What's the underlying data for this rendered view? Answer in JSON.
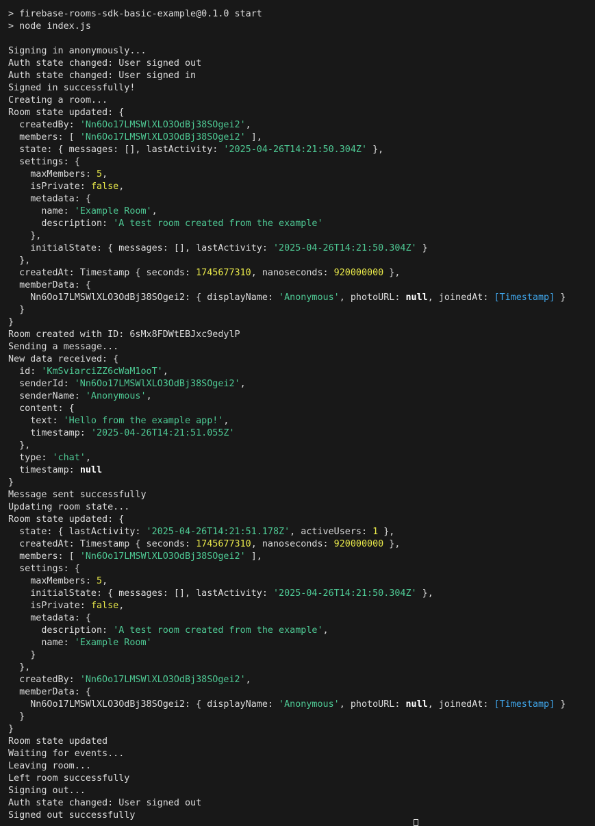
{
  "colors": {
    "background": "#181818",
    "text": "#dcdcdc",
    "string": "#4ec994",
    "number": "#e8e84a",
    "null": "#ffffff",
    "special": "#3fa4e8"
  },
  "lines": [
    [
      [
        "t",
        "> firebase-rooms-sdk-basic-example@0.1.0 start"
      ]
    ],
    [
      [
        "t",
        "> node index.js"
      ]
    ],
    [],
    [
      [
        "t",
        "Signing in anonymously..."
      ]
    ],
    [
      [
        "t",
        "Auth state changed: User signed out"
      ]
    ],
    [
      [
        "t",
        "Auth state changed: User signed in"
      ]
    ],
    [
      [
        "t",
        "Signed in successfully!"
      ]
    ],
    [
      [
        "t",
        "Creating a room..."
      ]
    ],
    [
      [
        "t",
        "Room state updated: {"
      ]
    ],
    [
      [
        "t",
        "  createdBy: "
      ],
      [
        "s",
        "'Nn6Oo17LMSWlXLO3OdBj38SOgei2'"
      ],
      [
        "t",
        ","
      ]
    ],
    [
      [
        "t",
        "  members: [ "
      ],
      [
        "s",
        "'Nn6Oo17LMSWlXLO3OdBj38SOgei2'"
      ],
      [
        "t",
        " ],"
      ]
    ],
    [
      [
        "t",
        "  state: { messages: [], lastActivity: "
      ],
      [
        "s",
        "'2025-04-26T14:21:50.304Z'"
      ],
      [
        "t",
        " },"
      ]
    ],
    [
      [
        "t",
        "  settings: {"
      ]
    ],
    [
      [
        "t",
        "    maxMembers: "
      ],
      [
        "n",
        "5"
      ],
      [
        "t",
        ","
      ]
    ],
    [
      [
        "t",
        "    isPrivate: "
      ],
      [
        "n",
        "false"
      ],
      [
        "t",
        ","
      ]
    ],
    [
      [
        "t",
        "    metadata: {"
      ]
    ],
    [
      [
        "t",
        "      name: "
      ],
      [
        "s",
        "'Example Room'"
      ],
      [
        "t",
        ","
      ]
    ],
    [
      [
        "t",
        "      description: "
      ],
      [
        "s",
        "'A test room created from the example'"
      ]
    ],
    [
      [
        "t",
        "    },"
      ]
    ],
    [
      [
        "t",
        "    initialState: { messages: [], lastActivity: "
      ],
      [
        "s",
        "'2025-04-26T14:21:50.304Z'"
      ],
      [
        "t",
        " }"
      ]
    ],
    [
      [
        "t",
        "  },"
      ]
    ],
    [
      [
        "t",
        "  createdAt: Timestamp { seconds: "
      ],
      [
        "n",
        "1745677310"
      ],
      [
        "t",
        ", nanoseconds: "
      ],
      [
        "n",
        "920000000"
      ],
      [
        "t",
        " },"
      ]
    ],
    [
      [
        "t",
        "  memberData: {"
      ]
    ],
    [
      [
        "t",
        "    Nn6Oo17LMSWlXLO3OdBj38SOgei2: { displayName: "
      ],
      [
        "s",
        "'Anonymous'"
      ],
      [
        "t",
        ", photoURL: "
      ],
      [
        "k",
        "null"
      ],
      [
        "t",
        ", joinedAt: "
      ],
      [
        "c",
        "[Timestamp]"
      ],
      [
        "t",
        " }"
      ]
    ],
    [
      [
        "t",
        "  }"
      ]
    ],
    [
      [
        "t",
        "}"
      ]
    ],
    [
      [
        "t",
        "Room created with ID: 6sMx8FDWtEBJxc9edylP"
      ]
    ],
    [
      [
        "t",
        "Sending a message..."
      ]
    ],
    [
      [
        "t",
        "New data received: {"
      ]
    ],
    [
      [
        "t",
        "  id: "
      ],
      [
        "s",
        "'KmSviarciZZ6cWaM1ooT'"
      ],
      [
        "t",
        ","
      ]
    ],
    [
      [
        "t",
        "  senderId: "
      ],
      [
        "s",
        "'Nn6Oo17LMSWlXLO3OdBj38SOgei2'"
      ],
      [
        "t",
        ","
      ]
    ],
    [
      [
        "t",
        "  senderName: "
      ],
      [
        "s",
        "'Anonymous'"
      ],
      [
        "t",
        ","
      ]
    ],
    [
      [
        "t",
        "  content: {"
      ]
    ],
    [
      [
        "t",
        "    text: "
      ],
      [
        "s",
        "'Hello from the example app!'"
      ],
      [
        "t",
        ","
      ]
    ],
    [
      [
        "t",
        "    timestamp: "
      ],
      [
        "s",
        "'2025-04-26T14:21:51.055Z'"
      ]
    ],
    [
      [
        "t",
        "  },"
      ]
    ],
    [
      [
        "t",
        "  type: "
      ],
      [
        "s",
        "'chat'"
      ],
      [
        "t",
        ","
      ]
    ],
    [
      [
        "t",
        "  timestamp: "
      ],
      [
        "k",
        "null"
      ]
    ],
    [
      [
        "t",
        "}"
      ]
    ],
    [
      [
        "t",
        "Message sent successfully"
      ]
    ],
    [
      [
        "t",
        "Updating room state..."
      ]
    ],
    [
      [
        "t",
        "Room state updated: {"
      ]
    ],
    [
      [
        "t",
        "  state: { lastActivity: "
      ],
      [
        "s",
        "'2025-04-26T14:21:51.178Z'"
      ],
      [
        "t",
        ", activeUsers: "
      ],
      [
        "n",
        "1"
      ],
      [
        "t",
        " },"
      ]
    ],
    [
      [
        "t",
        "  createdAt: Timestamp { seconds: "
      ],
      [
        "n",
        "1745677310"
      ],
      [
        "t",
        ", nanoseconds: "
      ],
      [
        "n",
        "920000000"
      ],
      [
        "t",
        " },"
      ]
    ],
    [
      [
        "t",
        "  members: [ "
      ],
      [
        "s",
        "'Nn6Oo17LMSWlXLO3OdBj38SOgei2'"
      ],
      [
        "t",
        " ],"
      ]
    ],
    [
      [
        "t",
        "  settings: {"
      ]
    ],
    [
      [
        "t",
        "    maxMembers: "
      ],
      [
        "n",
        "5"
      ],
      [
        "t",
        ","
      ]
    ],
    [
      [
        "t",
        "    initialState: { messages: [], lastActivity: "
      ],
      [
        "s",
        "'2025-04-26T14:21:50.304Z'"
      ],
      [
        "t",
        " },"
      ]
    ],
    [
      [
        "t",
        "    isPrivate: "
      ],
      [
        "n",
        "false"
      ],
      [
        "t",
        ","
      ]
    ],
    [
      [
        "t",
        "    metadata: {"
      ]
    ],
    [
      [
        "t",
        "      description: "
      ],
      [
        "s",
        "'A test room created from the example'"
      ],
      [
        "t",
        ","
      ]
    ],
    [
      [
        "t",
        "      name: "
      ],
      [
        "s",
        "'Example Room'"
      ]
    ],
    [
      [
        "t",
        "    }"
      ]
    ],
    [
      [
        "t",
        "  },"
      ]
    ],
    [
      [
        "t",
        "  createdBy: "
      ],
      [
        "s",
        "'Nn6Oo17LMSWlXLO3OdBj38SOgei2'"
      ],
      [
        "t",
        ","
      ]
    ],
    [
      [
        "t",
        "  memberData: {"
      ]
    ],
    [
      [
        "t",
        "    Nn6Oo17LMSWlXLO3OdBj38SOgei2: { displayName: "
      ],
      [
        "s",
        "'Anonymous'"
      ],
      [
        "t",
        ", photoURL: "
      ],
      [
        "k",
        "null"
      ],
      [
        "t",
        ", joinedAt: "
      ],
      [
        "c",
        "[Timestamp]"
      ],
      [
        "t",
        " }"
      ]
    ],
    [
      [
        "t",
        "  }"
      ]
    ],
    [
      [
        "t",
        "}"
      ]
    ],
    [
      [
        "t",
        "Room state updated"
      ]
    ],
    [
      [
        "t",
        "Waiting for events..."
      ]
    ],
    [
      [
        "t",
        "Leaving room..."
      ]
    ],
    [
      [
        "t",
        "Left room successfully"
      ]
    ],
    [
      [
        "t",
        "Signing out..."
      ]
    ],
    [
      [
        "t",
        "Auth state changed: User signed out"
      ]
    ],
    [
      [
        "t",
        "Signed out successfully"
      ]
    ]
  ]
}
